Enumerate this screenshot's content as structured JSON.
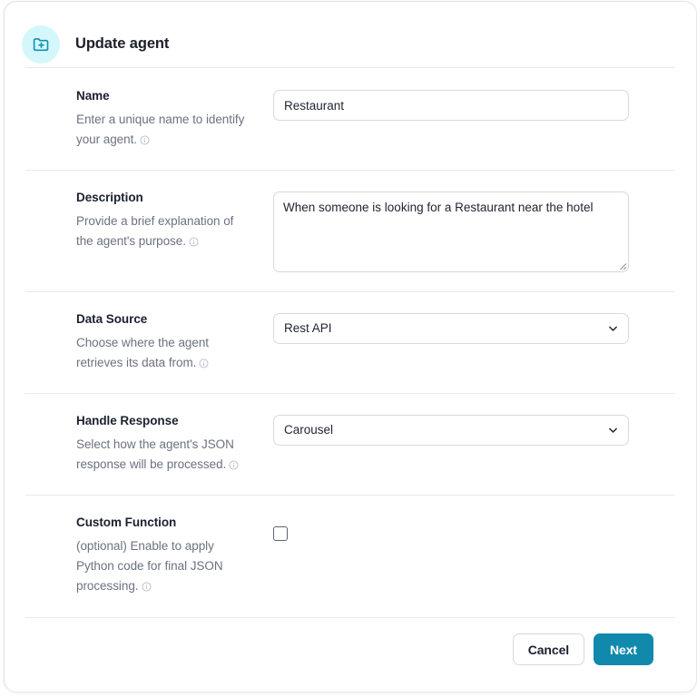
{
  "header": {
    "title": "Update agent",
    "icon": "folder-plus-icon",
    "icon_color": "#1193b4",
    "icon_bg": "#d4f7fb"
  },
  "theme": {
    "accent": "#1189ac",
    "text_primary": "#1b2030",
    "text_muted": "#6b7280",
    "border": "#d6d9de",
    "divider": "#e9eaed"
  },
  "form": {
    "fields": [
      {
        "id": "name",
        "title": "Name",
        "help": "Enter a unique name to identify your agent.",
        "info_icon": "info-circle-icon",
        "control": "text",
        "value": "Restaurant",
        "placeholder": ""
      },
      {
        "id": "description",
        "title": "Description",
        "help": "Provide a brief explanation of the agent's purpose.",
        "info_icon": "info-circle-icon",
        "control": "textarea",
        "value": "When someone is looking for a Restaurant near the hotel",
        "placeholder": ""
      },
      {
        "id": "data_source",
        "title": "Data Source",
        "help": "Choose where the agent retrieves its data from.",
        "info_icon": "info-circle-icon",
        "control": "select",
        "value": "Rest API",
        "options": [
          "Rest API"
        ]
      },
      {
        "id": "handle_response",
        "title": "Handle Response",
        "help": "Select how the agent's JSON response will be processed.",
        "info_icon": "info-circle-icon",
        "control": "select",
        "value": "Carousel",
        "options": [
          "Carousel"
        ]
      },
      {
        "id": "custom_function",
        "title": "Custom Function",
        "help": "(optional) Enable to apply Python code for final JSON processing.",
        "info_icon": "info-circle-icon",
        "control": "checkbox",
        "checked": false
      }
    ]
  },
  "footer": {
    "cancel_label": "Cancel",
    "next_label": "Next"
  }
}
